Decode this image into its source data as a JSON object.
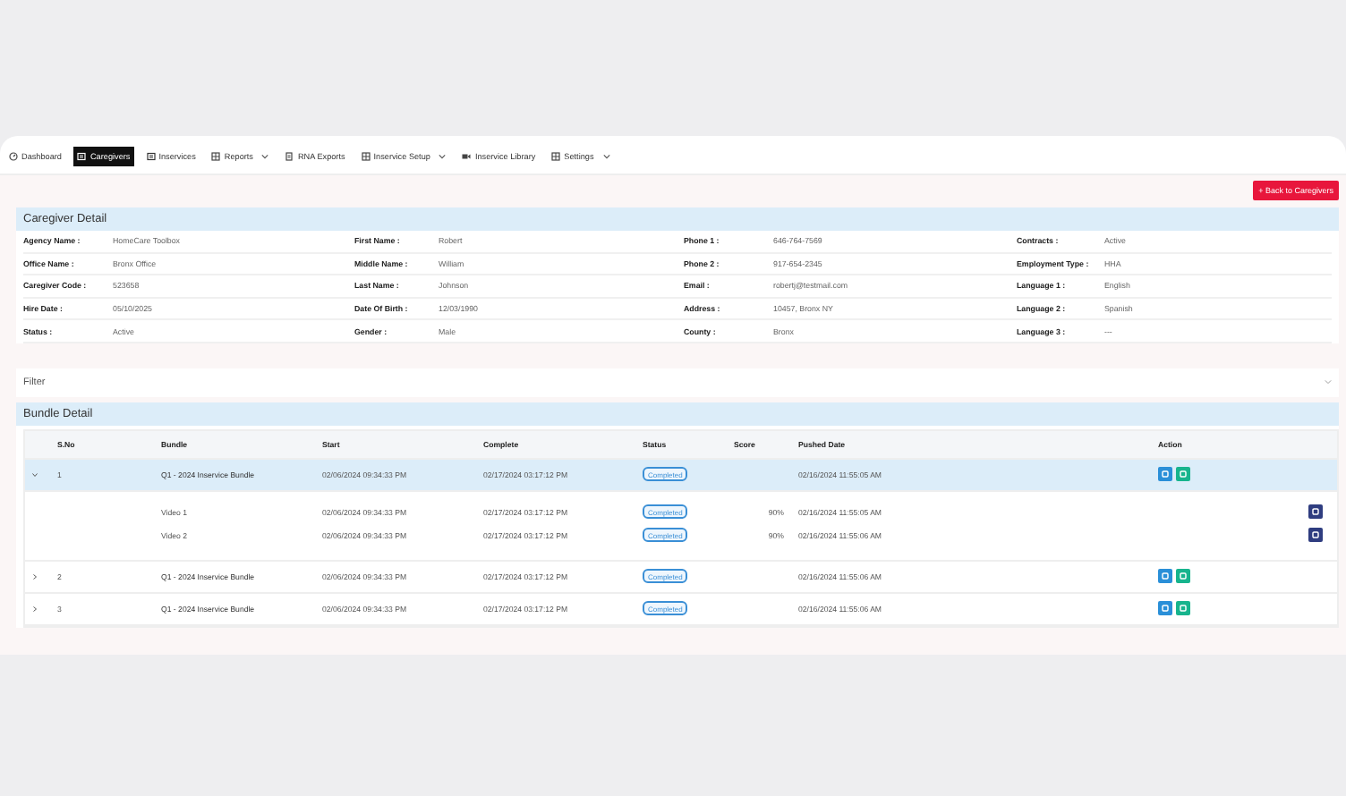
{
  "nav": [
    {
      "label": "Dashboard",
      "dropdown": false,
      "selected": false
    },
    {
      "label": "Caregivers",
      "dropdown": false,
      "selected": true
    },
    {
      "label": "Inservices",
      "dropdown": false,
      "selected": false
    },
    {
      "label": "Reports",
      "dropdown": true,
      "selected": false
    },
    {
      "label": "RNA Exports",
      "dropdown": false,
      "selected": false
    },
    {
      "label": "Inservice Setup",
      "dropdown": true,
      "selected": false
    },
    {
      "label": "Inservice Library",
      "dropdown": false,
      "selected": false
    },
    {
      "label": "Settings",
      "dropdown": true,
      "selected": false
    }
  ],
  "back_button": "+ Back to Caregivers",
  "caregiver_detail": {
    "title": "Caregiver Detail",
    "rows": [
      [
        {
          "label": "Agency Name :",
          "value": "HomeCare Toolbox"
        },
        {
          "label": "First Name :",
          "value": "Robert"
        },
        {
          "label": "Phone 1 :",
          "value": "646-764-7569"
        },
        {
          "label": "Contracts :",
          "value": "Active"
        }
      ],
      [
        {
          "label": "Office Name :",
          "value": "Bronx Office"
        },
        {
          "label": "Middle Name :",
          "value": "William"
        },
        {
          "label": "Phone 2 :",
          "value": "917-654-2345"
        },
        {
          "label": "Employment Type :",
          "value": "HHA"
        }
      ],
      [
        {
          "label": "Caregiver Code :",
          "value": "523658"
        },
        {
          "label": "Last Name :",
          "value": "Johnson"
        },
        {
          "label": "Email :",
          "value": "robertj@testmail.com"
        },
        {
          "label": "Language 1 :",
          "value": "English"
        }
      ],
      [
        {
          "label": "Hire Date :",
          "value": "05/10/2025"
        },
        {
          "label": "Date Of Birth :",
          "value": "12/03/1990"
        },
        {
          "label": "Address :",
          "value": "10457, Bronx NY"
        },
        {
          "label": "Language 2 :",
          "value": "Spanish"
        }
      ],
      [
        {
          "label": "Status :",
          "value": "Active"
        },
        {
          "label": "Gender :",
          "value": "Male"
        },
        {
          "label": "County :",
          "value": "Bronx"
        },
        {
          "label": "Language 3 :",
          "value": "---"
        }
      ]
    ]
  },
  "filter": {
    "title": "Filter",
    "expanded": false
  },
  "bundle_detail": {
    "title": "Bundle Detail",
    "columns": [
      "S.No",
      "Bundle",
      "Start",
      "Complete",
      "Status",
      "Score",
      "Pushed Date",
      "Action"
    ],
    "rows": [
      {
        "kind": "bundle",
        "expanded": true,
        "selected": true,
        "sno": "1",
        "bundle": "Q1 - 2024 Inservice Bundle",
        "start": "02/06/2024 09:34:33 PM",
        "complete": "02/17/2024 03:17:12 PM",
        "status": "Completed",
        "pushed": "02/16/2024 11:55:05 AM"
      },
      {
        "kind": "video",
        "bundle": "Video 1",
        "start": "02/06/2024 09:34:33 PM",
        "complete": "02/17/2024 03:17:12 PM",
        "status": "Completed",
        "score": "90%",
        "pushed": "02/16/2024 11:55:05 AM"
      },
      {
        "kind": "video",
        "bundle": "Video 2",
        "start": "02/06/2024 09:34:33 PM",
        "complete": "02/17/2024 03:17:12 PM",
        "status": "Completed",
        "score": "90%",
        "pushed": "02/16/2024 11:55:06 AM"
      },
      {
        "kind": "bundle",
        "expanded": false,
        "selected": false,
        "sno": "2",
        "bundle": "Q1 - 2024 Inservice Bundle",
        "start": "02/06/2024 09:34:33 PM",
        "complete": "02/17/2024 03:17:12 PM",
        "status": "Completed",
        "pushed": "02/16/2024 11:55:06 AM"
      },
      {
        "kind": "bundle",
        "expanded": false,
        "selected": false,
        "sno": "3",
        "bundle": "Q1 - 2024 Inservice Bundle",
        "start": "02/06/2024 09:34:33 PM",
        "complete": "02/17/2024 03:17:12 PM",
        "status": "Completed",
        "pushed": "02/16/2024 11:55:06 AM"
      }
    ]
  }
}
